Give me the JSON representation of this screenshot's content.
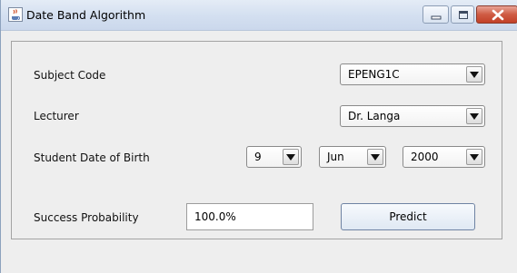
{
  "window": {
    "title": "Date Band Algorithm",
    "app_icon": "java-cup-icon",
    "controls": [
      "minimize-icon",
      "maximize-icon",
      "close-icon"
    ]
  },
  "form": {
    "subject_code": {
      "label": "Subject Code",
      "value": "EPENG1C"
    },
    "lecturer": {
      "label": "Lecturer",
      "value": "Dr. Langa"
    },
    "dob": {
      "label": "Student Date of Birth",
      "day": "9",
      "month": "Jun",
      "year": "2000"
    },
    "success": {
      "label": "Success Probability",
      "value": "100.0%"
    },
    "predict_label": "Predict"
  },
  "colors": {
    "titlebar": "#d3dff0",
    "close_button": "#c94a31",
    "panel_bg": "#eeeeee"
  }
}
